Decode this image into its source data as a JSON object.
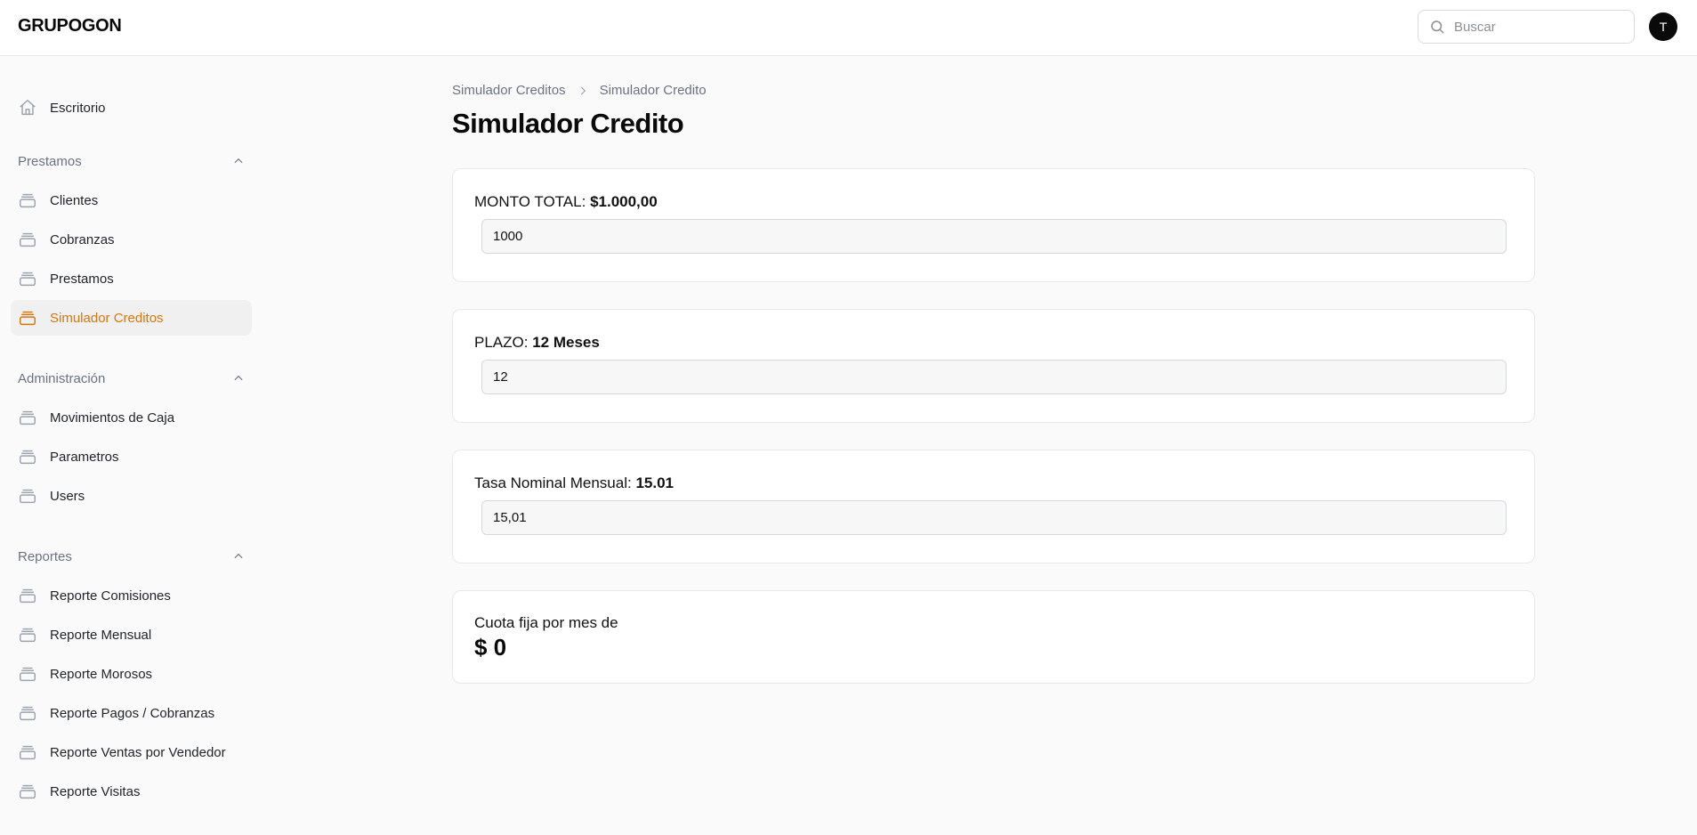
{
  "header": {
    "brand": "GRUPOGON",
    "search_placeholder": "Buscar",
    "avatar_initial": "T"
  },
  "sidebar": {
    "home": {
      "label": "Escritorio",
      "icon": "home-icon"
    },
    "groups": [
      {
        "label": "Prestamos",
        "items": [
          {
            "label": "Clientes"
          },
          {
            "label": "Cobranzas"
          },
          {
            "label": "Prestamos"
          },
          {
            "label": "Simulador Creditos",
            "active": true
          }
        ]
      },
      {
        "label": "Administración",
        "items": [
          {
            "label": "Movimientos de Caja"
          },
          {
            "label": "Parametros"
          },
          {
            "label": "Users"
          }
        ]
      },
      {
        "label": "Reportes",
        "items": [
          {
            "label": "Reporte Comisiones"
          },
          {
            "label": "Reporte Mensual"
          },
          {
            "label": "Reporte Morosos"
          },
          {
            "label": "Reporte Pagos / Cobranzas"
          },
          {
            "label": "Reporte Ventas por Vendedor"
          },
          {
            "label": "Reporte Visitas"
          }
        ]
      }
    ]
  },
  "breadcrumb": {
    "parent": "Simulador Creditos",
    "current": "Simulador Credito"
  },
  "page_title": "Simulador Credito",
  "form": {
    "monto": {
      "label": "MONTO TOTAL:",
      "display": "$1.000,00",
      "value": "1000"
    },
    "plazo": {
      "label": "PLAZO:",
      "display": "12 Meses",
      "value": "12"
    },
    "tasa": {
      "label": "Tasa Nominal Mensual:",
      "display": "15.01",
      "value": "15,01"
    }
  },
  "result": {
    "label": "Cuota fija por mes de",
    "value": "$ 0"
  },
  "colors": {
    "accent": "#d97706",
    "icon_gray": "#9ca3af",
    "active_bg": "#f0f0f0"
  }
}
